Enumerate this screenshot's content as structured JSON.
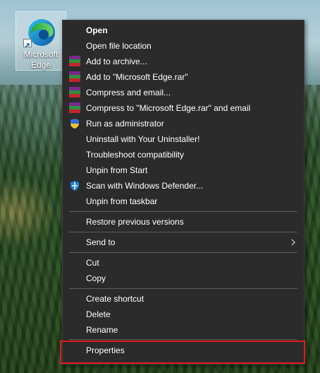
{
  "desktop": {
    "icon_label": "Microsoft Edge",
    "icon_name": "microsoft-edge-icon",
    "colors": {
      "selection": "#e0191e",
      "menu_bg": "#2b2b2b"
    }
  },
  "context_menu": {
    "open": "Open",
    "open_file_location": "Open file location",
    "add_to_archive": "Add to archive...",
    "add_to_rar": "Add to \"Microsoft Edge.rar\"",
    "compress_and_email": "Compress and email...",
    "compress_to_rar_email": "Compress to \"Microsoft Edge.rar\" and email",
    "run_as_admin": "Run as administrator",
    "uninstall": "Uninstall with Your Uninstaller!",
    "troubleshoot": "Troubleshoot compatibility",
    "unpin_start": "Unpin from Start",
    "scan_defender": "Scan with Windows Defender...",
    "unpin_taskbar": "Unpin from taskbar",
    "restore_versions": "Restore previous versions",
    "send_to": "Send to",
    "cut": "Cut",
    "copy": "Copy",
    "create_shortcut": "Create shortcut",
    "delete": "Delete",
    "rename": "Rename",
    "properties": "Properties"
  }
}
